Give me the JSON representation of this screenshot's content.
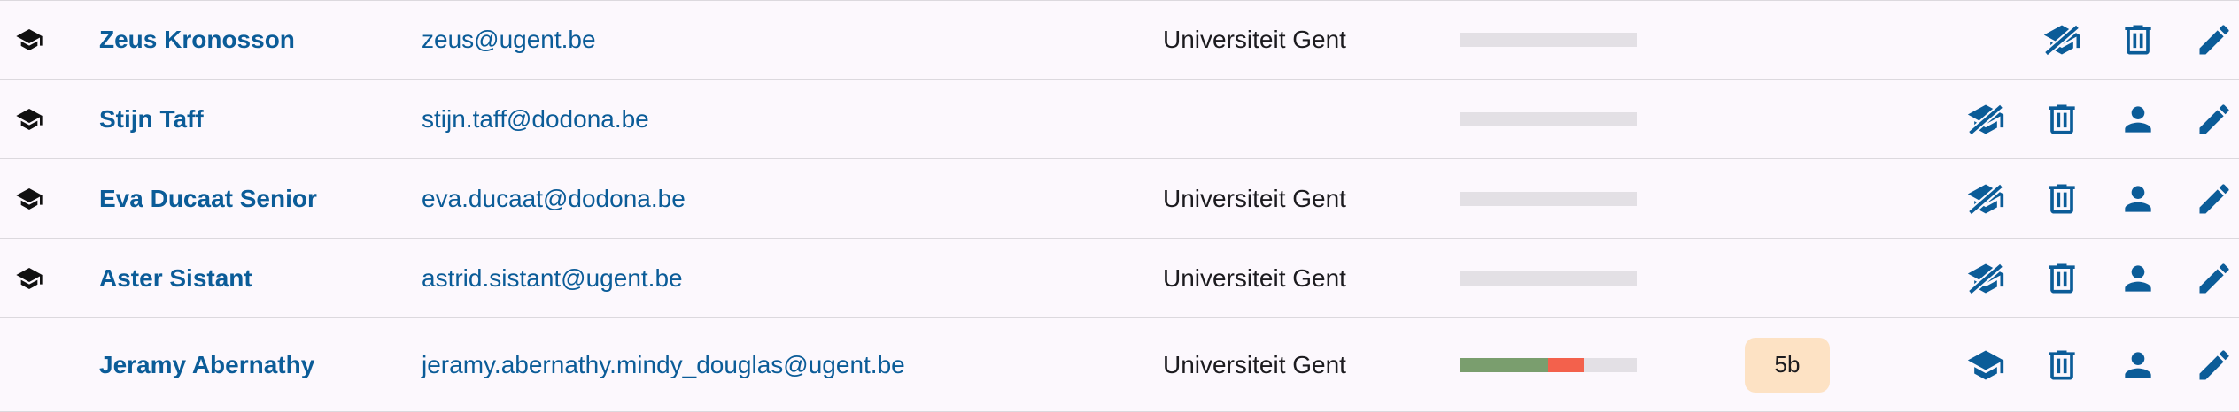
{
  "colors": {
    "link": "#0b5c98",
    "correct": "#7a9e6e",
    "wrong": "#f3614c",
    "empty": "#e3e0e5",
    "badge_bg": "#fde2c4"
  },
  "users": [
    {
      "admin_icon": "school-icon",
      "name": "Zeus Kronosson",
      "email": "zeus@ugent.be",
      "institution": "Universiteit Gent",
      "progress": {
        "correct": 0,
        "wrong": 0
      },
      "badge": "",
      "actions": [
        "remove-admin-icon",
        "delete-icon",
        "edit-icon"
      ]
    },
    {
      "admin_icon": "school-icon",
      "name": "Stijn Taff",
      "email": "stijn.taff@dodona.be",
      "institution": "",
      "progress": {
        "correct": 0,
        "wrong": 0
      },
      "badge": "",
      "actions": [
        "remove-admin-icon",
        "delete-icon",
        "impersonate-icon",
        "edit-icon"
      ]
    },
    {
      "admin_icon": "school-icon",
      "name": "Eva Ducaat Senior",
      "email": "eva.ducaat@dodona.be",
      "institution": "Universiteit Gent",
      "progress": {
        "correct": 0,
        "wrong": 0
      },
      "badge": "",
      "actions": [
        "remove-admin-icon",
        "delete-icon",
        "impersonate-icon",
        "edit-icon"
      ]
    },
    {
      "admin_icon": "school-icon",
      "name": "Aster Sistant",
      "email": "astrid.sistant@ugent.be",
      "institution": "Universiteit Gent",
      "progress": {
        "correct": 0,
        "wrong": 0
      },
      "badge": "",
      "actions": [
        "remove-admin-icon",
        "delete-icon",
        "impersonate-icon",
        "edit-icon"
      ]
    },
    {
      "admin_icon": "",
      "name": "Jeramy Abernathy",
      "email": "jeramy.abernathy.mindy_douglas@ugent.be",
      "institution": "Universiteit Gent",
      "progress": {
        "correct": 0.5,
        "wrong": 0.2
      },
      "badge": "5b",
      "actions": [
        "make-admin-icon",
        "delete-icon",
        "impersonate-icon",
        "edit-icon"
      ]
    }
  ]
}
